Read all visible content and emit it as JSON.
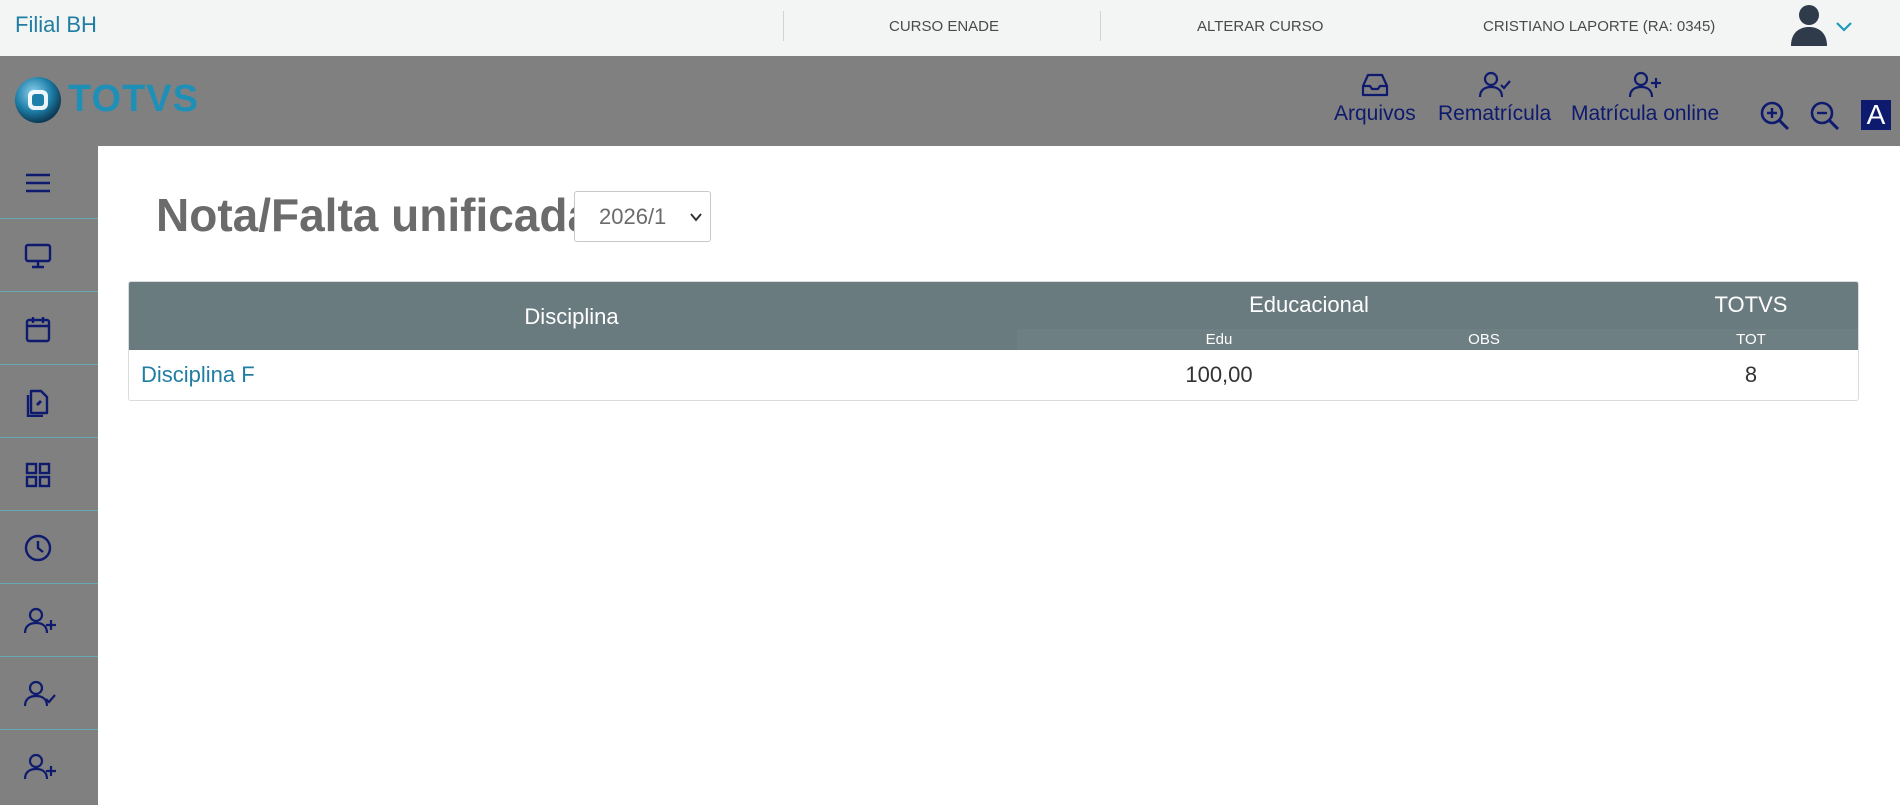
{
  "topbar": {
    "filial": "Filial BH",
    "course": "CURSO ENADE",
    "change_course": "ALTERAR CURSO",
    "user": "CRISTIANO LAPORTE (RA: 0345)"
  },
  "header": {
    "logo_text": "TOTVS",
    "buttons": [
      {
        "label": "Arquivos",
        "icon": "inbox-icon"
      },
      {
        "label": "Rematrícula",
        "icon": "user-check-icon"
      },
      {
        "label": "Matrícula online",
        "icon": "user-plus-icon"
      }
    ],
    "zoom_in_icon": "zoom-in-icon",
    "zoom_out_icon": "zoom-out-icon",
    "font_toggle": "A"
  },
  "sidebar": {
    "items": [
      {
        "icon": "menu-icon"
      },
      {
        "icon": "monitor-icon"
      },
      {
        "icon": "calendar-icon"
      },
      {
        "icon": "documents-icon"
      },
      {
        "icon": "grid-icon"
      },
      {
        "icon": "clock-icon"
      },
      {
        "icon": "user-plus-icon"
      },
      {
        "icon": "user-check-icon"
      },
      {
        "icon": "user-plus-icon"
      }
    ]
  },
  "main": {
    "title": "Nota/Falta unificada:",
    "period_selected": "2026/1",
    "table": {
      "col_disciplina": "Disciplina",
      "group_educacional": "Educacional",
      "group_totvs": "TOTVS",
      "sub_edu": "Edu",
      "sub_obs": "OBS",
      "sub_tot": "TOT",
      "rows": [
        {
          "disciplina": "Disciplina F",
          "edu": "100,00",
          "obs": "",
          "tot": "8"
        }
      ]
    }
  },
  "colors": {
    "topbar_bg": "#f3f5f5",
    "header_bg": "#808080",
    "accent_link": "#1f7ea1",
    "icon_navy": "#0d1a6e",
    "table_header_bg": "#6a7b7f"
  }
}
